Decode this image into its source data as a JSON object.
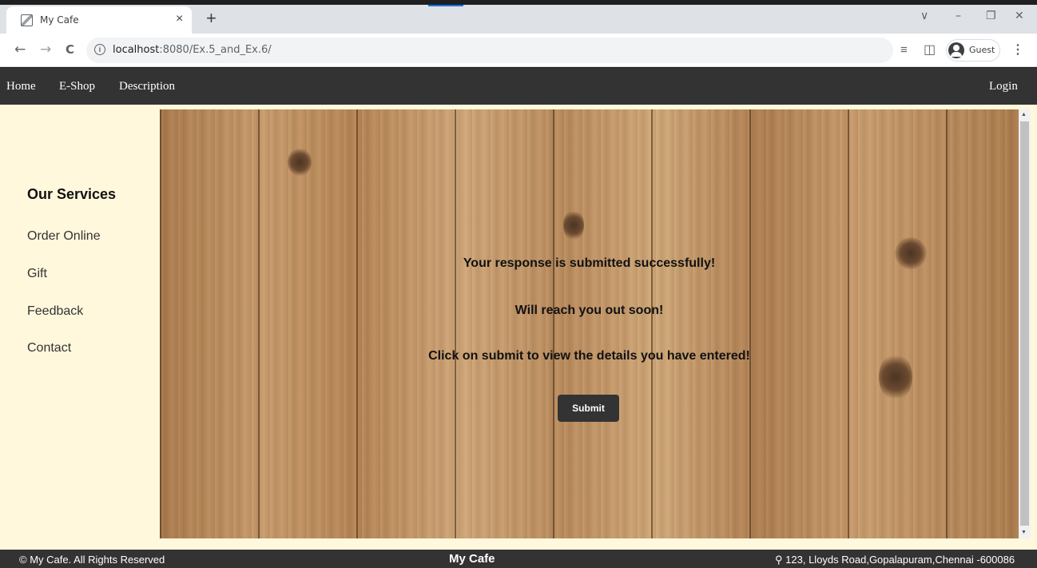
{
  "browser": {
    "tab_title": "My Cafe",
    "tab_close": "×",
    "new_tab": "+",
    "url_host": "localhost",
    "url_rest": ":8080/Ex.5_and_Ex.6/",
    "profile_label": "Guest",
    "icons": {
      "favicon": "image-icon",
      "back": "back-arrow-icon",
      "forward": "forward-arrow-icon",
      "reload": "reload-icon",
      "info": "info-icon",
      "reading_list": "reading-list-icon",
      "side_panel": "side-panel-icon",
      "menu": "kebab-menu-icon"
    },
    "glyphs": {
      "back": "←",
      "forward": "→",
      "reload": "C",
      "info": "i",
      "reading_list": "≡",
      "side_panel": "◫",
      "menu": "⋮",
      "chevron": "∨",
      "minimize": "–",
      "restore": "❐",
      "close": "✕"
    }
  },
  "navbar": {
    "links": [
      "Home",
      "E-Shop",
      "Description"
    ],
    "login": "Login"
  },
  "sidebar": {
    "heading": "Our Services",
    "items": [
      "Order Online",
      "Gift",
      "Feedback",
      "Contact"
    ]
  },
  "main": {
    "messages": [
      "Your response is submitted successfully!",
      "Will reach you out soon!",
      "Click on submit to view the details you have entered!"
    ],
    "submit_label": "Submit"
  },
  "footer": {
    "copyright": "© My Cafe. All Rights Reserved",
    "brand": "My Cafe",
    "address": "123, Lloyds Road,Gopalapuram,Chennai -600086",
    "address_icon": "map-marker-icon",
    "address_glyph": "⚲"
  },
  "colors": {
    "navbar_bg": "#333333",
    "sidebar_bg": "#fff8dc",
    "button_bg": "#333333",
    "wood": "#c69a6b"
  }
}
